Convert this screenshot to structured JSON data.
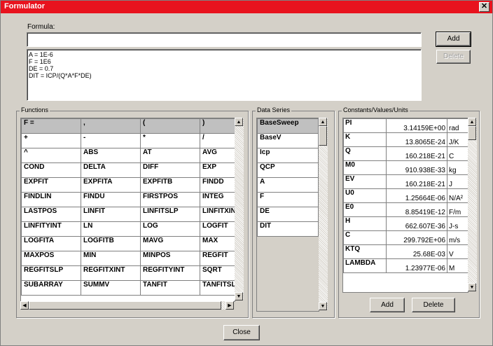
{
  "window": {
    "title": "Formulator"
  },
  "formula": {
    "label": "Formula:",
    "value": ""
  },
  "buttons": {
    "add": "Add",
    "delete": "Delete",
    "close": "Close",
    "const_add": "Add",
    "const_delete": "Delete"
  },
  "formula_lines": [
    "A = 1E-6",
    "F = 1E6",
    "DE = 0.7",
    "DIT = ICP/(Q*A*F*DE)"
  ],
  "groups": {
    "functions": "Functions",
    "data_series": "Data Series",
    "constants": "Constants/Values/Units"
  },
  "functions": [
    [
      "F =",
      ",",
      "(",
      ")"
    ],
    [
      "+",
      "-",
      "*",
      "/"
    ],
    [
      "^",
      "ABS",
      "AT",
      "AVG"
    ],
    [
      "COND",
      "DELTA",
      "DIFF",
      "EXP"
    ],
    [
      "EXPFIT",
      "EXPFITA",
      "EXPFITB",
      "FINDD"
    ],
    [
      "FINDLIN",
      "FINDU",
      "FIRSTPOS",
      "INTEG"
    ],
    [
      "LASTPOS",
      "LINFIT",
      "LINFITSLP",
      "LINFITXIN"
    ],
    [
      "LINFITYINT",
      "LN",
      "LOG",
      "LOGFIT"
    ],
    [
      "LOGFITA",
      "LOGFITB",
      "MAVG",
      "MAX"
    ],
    [
      "MAXPOS",
      "MIN",
      "MINPOS",
      "REGFIT"
    ],
    [
      "REGFITSLP",
      "REGFITXINT",
      "REGFITYINT",
      "SQRT"
    ],
    [
      "SUBARRAY",
      "SUMMV",
      "TANFIT",
      "TANFITSL"
    ]
  ],
  "data_series": [
    "BaseSweep",
    "BaseV",
    "Icp",
    "QCP",
    "A",
    "F",
    "DE",
    "DIT"
  ],
  "constants": [
    {
      "name": "PI",
      "value": "3.14159E+00",
      "unit": "rad"
    },
    {
      "name": "K",
      "value": "13.8065E-24",
      "unit": "J/K"
    },
    {
      "name": "Q",
      "value": "160.218E-21",
      "unit": "C"
    },
    {
      "name": "M0",
      "value": "910.938E-33",
      "unit": "kg"
    },
    {
      "name": "EV",
      "value": "160.218E-21",
      "unit": "J"
    },
    {
      "name": "U0",
      "value": "1.25664E-06",
      "unit": "N/A²"
    },
    {
      "name": "E0",
      "value": "8.85419E-12",
      "unit": "F/m"
    },
    {
      "name": "H",
      "value": "662.607E-36",
      "unit": "J-s"
    },
    {
      "name": "C",
      "value": "299.792E+06",
      "unit": "m/s"
    },
    {
      "name": "KTQ",
      "value": "25.68E-03",
      "unit": "V"
    },
    {
      "name": "LAMBDA",
      "value": "1.23977E-06",
      "unit": "M"
    }
  ],
  "colors": {
    "titlebar": "#e8131e",
    "face": "#d4d0c8"
  }
}
